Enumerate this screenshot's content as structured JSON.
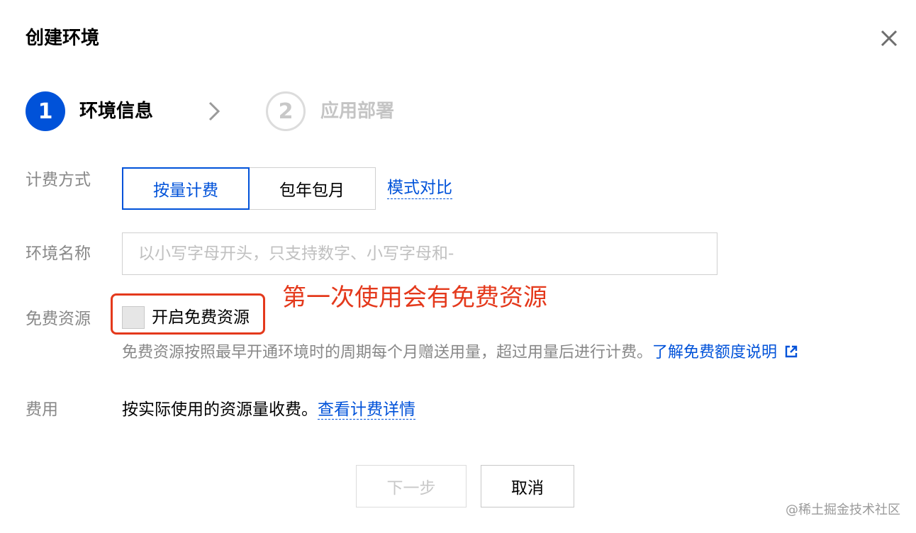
{
  "dialog": {
    "title": "创建环境"
  },
  "steps": [
    {
      "number": "1",
      "label": "环境信息",
      "state": "active"
    },
    {
      "number": "2",
      "label": "应用部署",
      "state": "inactive"
    }
  ],
  "billing": {
    "label": "计费方式",
    "options": [
      "按量计费",
      "包年包月"
    ],
    "selected": "按量计费",
    "compare_link": "模式对比"
  },
  "env_name": {
    "label": "环境名称",
    "value": "",
    "placeholder": "以小写字母开头，只支持数字、小写字母和-"
  },
  "free_resource": {
    "label": "免费资源",
    "checkbox_label": "开启免费资源",
    "checked": false,
    "annotation": "第一次使用会有免费资源",
    "help_text": "免费资源按照最早开通环境时的周期每个月赠送用量，超过用量后进行计费。",
    "help_link": "了解免费额度说明"
  },
  "fee": {
    "label": "费用",
    "text": "按实际使用的资源量收费。",
    "link": "查看计费详情"
  },
  "footer": {
    "next_label": "下一步",
    "cancel_label": "取消"
  },
  "watermark": "@稀土掘金技术社区",
  "colors": {
    "primary": "#0052d9",
    "annotation_red": "#e4391c",
    "label_gray": "#888888",
    "disabled_gray": "#c8c8c8"
  },
  "icons": {
    "close": "close-icon",
    "step_arrow": "chevron-right-icon",
    "external_link": "external-link-icon"
  }
}
